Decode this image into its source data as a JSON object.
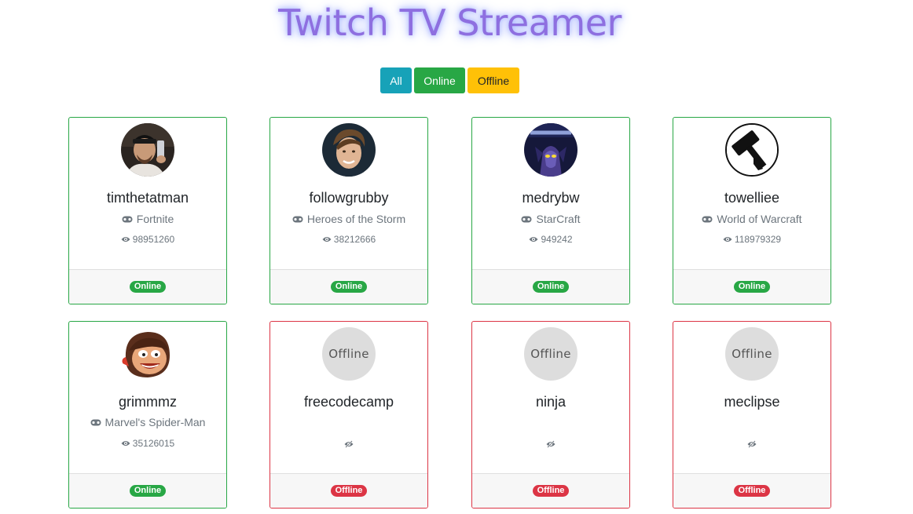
{
  "header": {
    "title": "Twitch TV Streamer"
  },
  "filters": {
    "all_label": "All",
    "online_label": "Online",
    "offline_label": "Offline"
  },
  "colors": {
    "online": "#28a745",
    "offline": "#dc3545",
    "all": "#17a2b8",
    "warning": "#ffc107",
    "title": "#8e6fe0"
  },
  "streamers": [
    {
      "name": "timthetatman",
      "game": "Fortnite",
      "viewers": "98951260",
      "status": "Online",
      "avatar_icon": "streamer-photo-icon"
    },
    {
      "name": "followgrubby",
      "game": "Heroes of the Storm",
      "viewers": "38212666",
      "status": "Online",
      "avatar_icon": "streamer-photo-icon"
    },
    {
      "name": "medrybw",
      "game": "StarCraft",
      "viewers": "949242",
      "status": "Online",
      "avatar_icon": "starcraft-logo-icon"
    },
    {
      "name": "towelliee",
      "game": "World of Warcraft",
      "viewers": "118979329",
      "status": "Online",
      "avatar_icon": "hammer-logo-icon"
    },
    {
      "name": "grimmmz",
      "game": "Marvel's Spider-Man",
      "viewers": "35126015",
      "status": "Online",
      "avatar_icon": "cartoon-face-icon"
    },
    {
      "name": "freecodecamp",
      "avatar_text": "Offline",
      "status": "Offline"
    },
    {
      "name": "ninja",
      "avatar_text": "Offline",
      "status": "Offline"
    },
    {
      "name": "meclipse",
      "avatar_text": "Offline",
      "status": "Offline"
    }
  ]
}
